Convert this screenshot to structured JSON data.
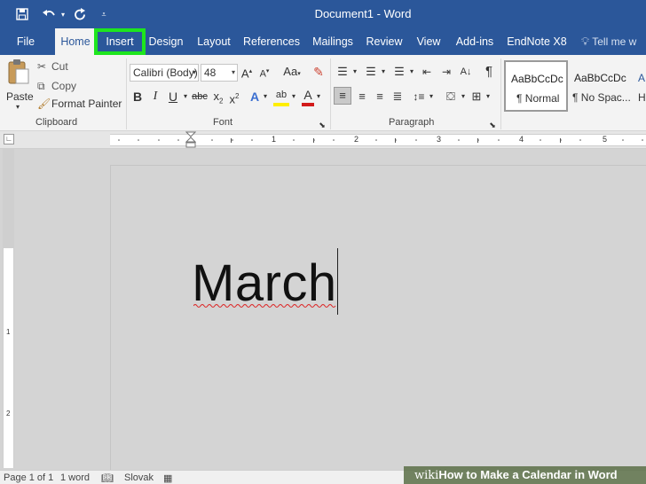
{
  "window": {
    "title": "Document1  -  Word"
  },
  "quick_access": {
    "icons": [
      "save-icon",
      "undo-icon",
      "redo-icon",
      "customize-icon"
    ]
  },
  "tabs": {
    "file": "File",
    "home": "Home",
    "insert": "Insert",
    "design": "Design",
    "layout": "Layout",
    "references": "References",
    "mailings": "Mailings",
    "review": "Review",
    "view": "View",
    "addins": "Add-ins",
    "endnote": "EndNote X8",
    "tellme": "Tell me w"
  },
  "ribbon": {
    "clipboard": {
      "label": "Clipboard",
      "paste": "Paste",
      "cut": "Cut",
      "copy": "Copy",
      "format_painter": "Format Painter"
    },
    "font": {
      "label": "Font",
      "font_name": "Calibri (Body)",
      "font_size": "48"
    },
    "paragraph": {
      "label": "Paragraph"
    },
    "styles": {
      "normal_sample": "AaBbCcDc",
      "normal_name": "¶ Normal",
      "nospacing_sample": "AaBbCcDc",
      "nospacing_name": "¶ No Spac...",
      "heading_sample": "A",
      "heading_name": "H"
    }
  },
  "ruler": {
    "labels": [
      "1",
      "2",
      "3",
      "4",
      "5"
    ]
  },
  "vruler": {
    "labels": [
      "1",
      "2"
    ]
  },
  "document": {
    "text": "March"
  },
  "status": {
    "page": "Page 1 of 1",
    "words": "1 word",
    "language": "Slovak"
  },
  "watermark": {
    "wiki": "wiki",
    "rest": "How to Make a Calendar in Word"
  },
  "colors": {
    "brand": "#2b579a",
    "highlight": "#1ee51e"
  }
}
